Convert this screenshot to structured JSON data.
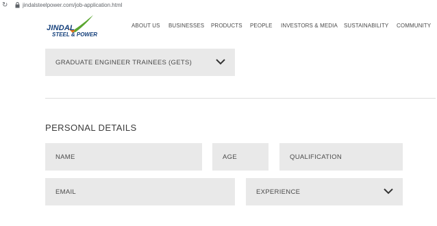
{
  "browser": {
    "url": "jindalsteelpower.com/job-application.html",
    "reload_icon": "reload-icon",
    "lock_icon": "lock-icon"
  },
  "brand": {
    "name": "JINDAL",
    "subtitle": "STEEL & POWER",
    "swoosh_color": "#5aa630"
  },
  "nav": {
    "items": [
      "ABOUT US",
      "BUSINESSES",
      "PRODUCTS",
      "PEOPLE",
      "INVESTORS & MEDIA",
      "SUSTAINABILITY",
      "COMMUNITY"
    ]
  },
  "position_select": {
    "value": "GRADUATE ENGINEER TRAINEES (GETS)",
    "icon": "chevron-down-icon"
  },
  "personal": {
    "title": "PERSONAL DETAILS",
    "name_placeholder": "NAME",
    "age_placeholder": "AGE",
    "qualification_placeholder": "QUALIFICATION",
    "email_placeholder": "EMAIL",
    "experience_placeholder": "EXPERIENCE"
  },
  "colors": {
    "field_bg": "#e9e9e9",
    "brand_blue": "#123e7a",
    "text": "#4a4a4a"
  }
}
